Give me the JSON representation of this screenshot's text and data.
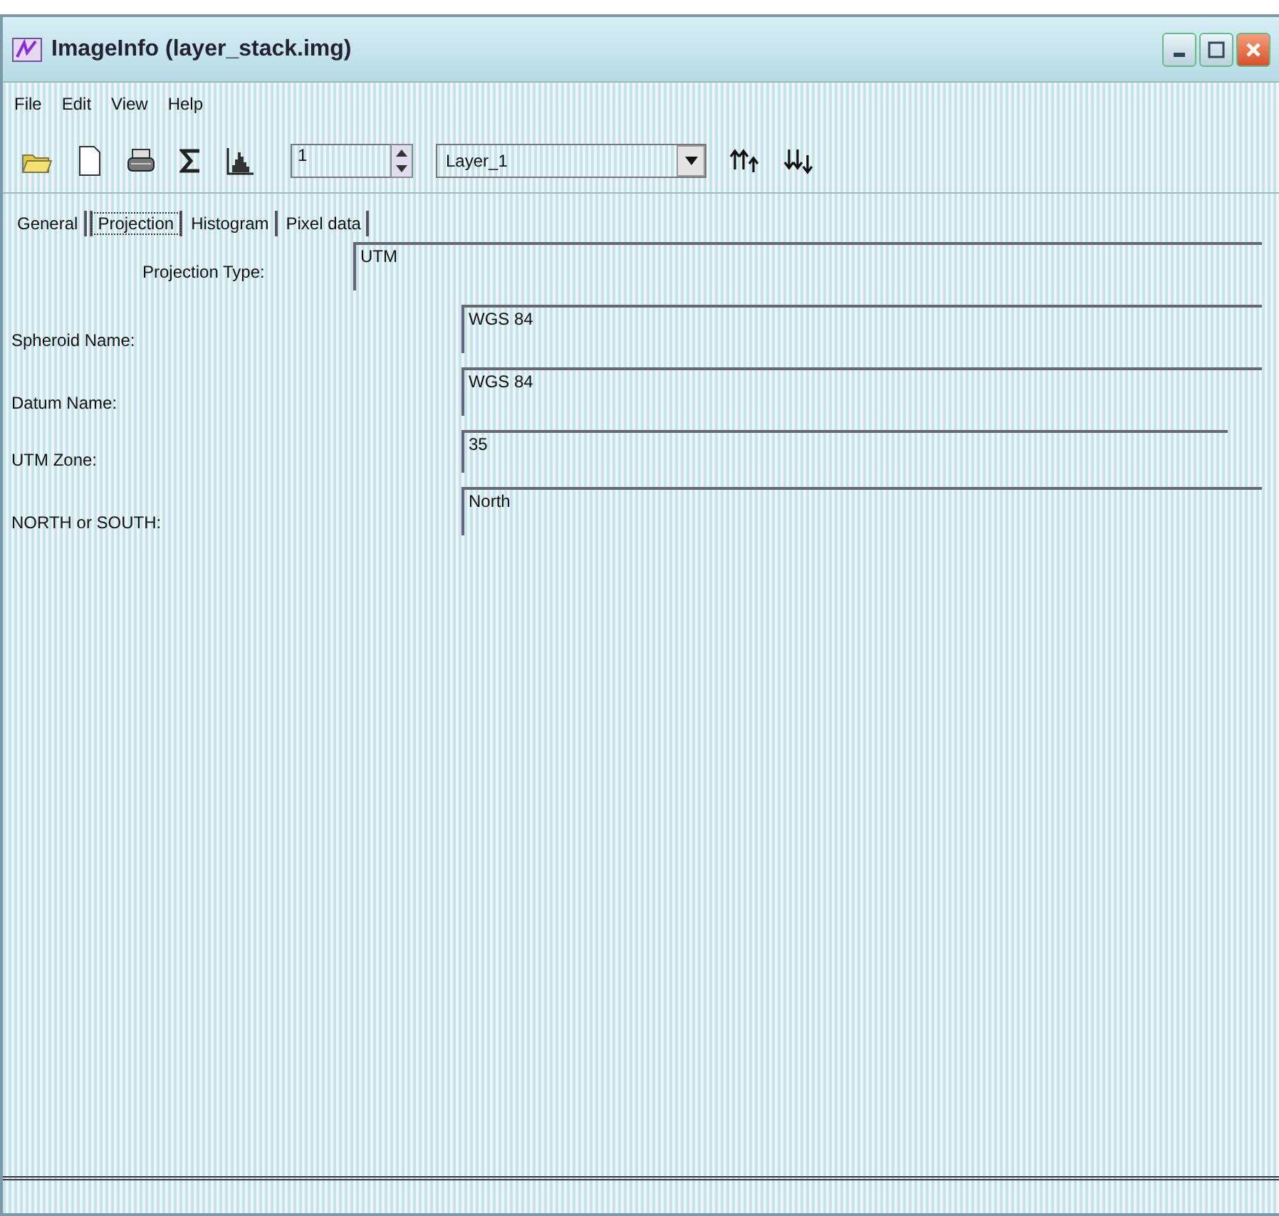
{
  "window": {
    "title": "ImageInfo (layer_stack.img)"
  },
  "menu": [
    "File",
    "Edit",
    "View",
    "Help"
  ],
  "toolbar": {
    "layer_number": "1",
    "layer_name": "Layer_1"
  },
  "tabs": [
    {
      "label": "General",
      "selected": false
    },
    {
      "label": "Projection",
      "selected": true
    },
    {
      "label": "Histogram",
      "selected": false
    },
    {
      "label": "Pixel data",
      "selected": false
    }
  ],
  "projection_type": {
    "label": "Projection Type:",
    "value": "UTM"
  },
  "fields": [
    {
      "label": "Spheroid Name:",
      "value": "WGS 84",
      "kind": "wide"
    },
    {
      "label": "Datum Name:",
      "value": "WGS 84",
      "kind": "wide"
    },
    {
      "label": "UTM Zone:",
      "value": "35",
      "kind": "narrow"
    },
    {
      "label": "NORTH or SOUTH:",
      "value": "North",
      "kind": "wide"
    }
  ]
}
